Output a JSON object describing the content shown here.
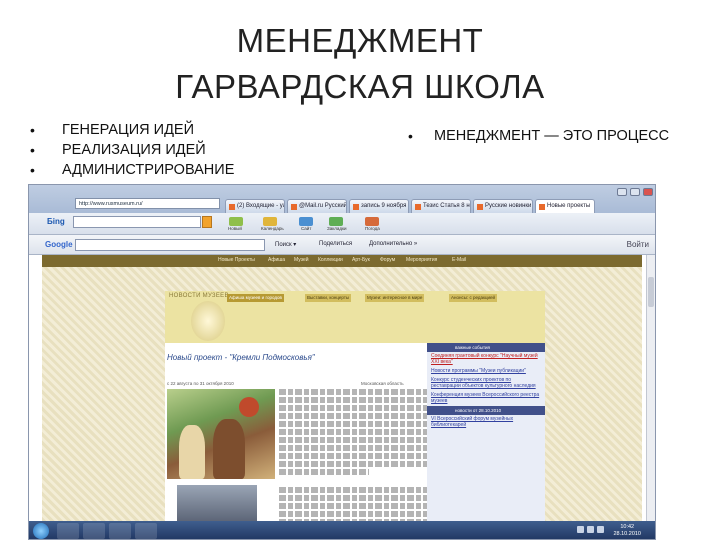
{
  "slide": {
    "title_line1": "МЕНЕДЖМЕНТ",
    "title_line2": "ГАРВАРДСКАЯ ШКОЛА",
    "bullets_left": [
      "ГЕНЕРАЦИЯ ИДЕЙ",
      "РЕАЛИЗАЦИЯ ИДЕЙ",
      "АДМИНИСТРИРОВАНИЕ"
    ],
    "bullet_right": "МЕНЕДЖМЕНТ — ЭТО ПРОЦЕСС"
  },
  "browser": {
    "address": "http://www.rusmuseum.ru/",
    "tabs": [
      "(2) Входящие - ya...",
      "@Mail.ru Русский",
      "запись 9 ноября",
      "Тезис Статья 8 ноя...",
      "Русские новинки",
      "Новые проекты"
    ],
    "toolbar1": {
      "search_logo": "Бing",
      "tools": [
        "Новый",
        "Календарь",
        "Сайт",
        "Закладки",
        "Погода"
      ]
    },
    "toolbar2": {
      "logo": "Google",
      "items": [
        "Поиск ▾",
        "Поделиться",
        "Дополнительно »"
      ],
      "settings": "Войти"
    }
  },
  "website": {
    "top_nav": [
      "Новые Проекты",
      "Афиша",
      "Музей",
      "Коллекции",
      "Арт-Бук",
      "Форум",
      "Мероприятия",
      "E-Mail"
    ],
    "header_logo": "НОВОСТИ МУЗЕЕВ",
    "header_nav": [
      "Афиша музеев и городов",
      "Выставки, концерты",
      "Музеи: интересное в мире",
      "Анонсы: с редакцией"
    ],
    "article_title": "Новый проект - \"Кремли Подмосковья\"",
    "article_date": "с 22 августа по 31 октября 2010",
    "article_source": "Московская область",
    "sidebar": {
      "news_header": "важные события",
      "news_items": [
        "Соединяя грантовый конкурс \"Научный музей XXI века\"",
        "Новости программы \"Музеи публикации\"",
        "Конкурс студенческих проектов по реставрации объектов культурного наследия"
      ],
      "news_header2": "Конференция музеев Всероссийского реестра музеев",
      "date_header": "новости от 28.10.2010",
      "date_item": "VI Всероссийский форум музейных библиотекарей"
    }
  },
  "taskbar": {
    "time": "10:42",
    "date": "28.10.2010"
  }
}
